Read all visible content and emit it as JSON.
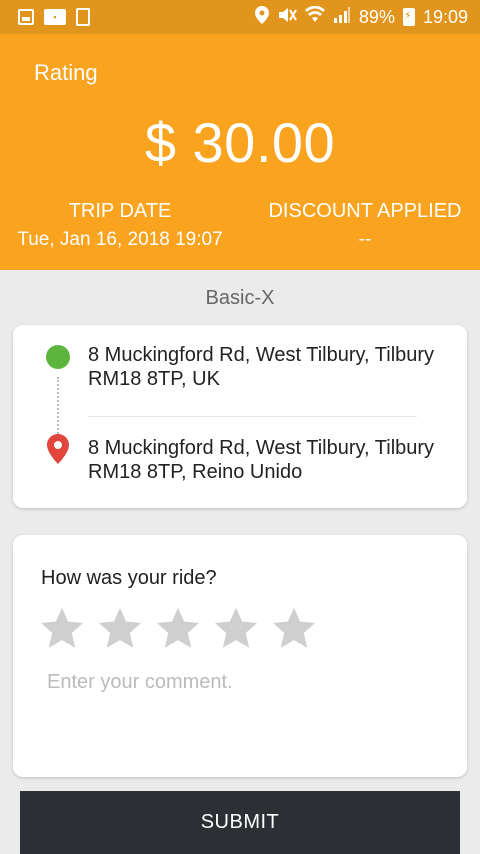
{
  "status_bar": {
    "battery": "89%",
    "time": "19:09",
    "icons": [
      "gallery-icon",
      "app-notification-icon",
      "document-icon",
      "location-icon",
      "mute-icon",
      "wifi-icon",
      "signal-icon",
      "battery-charging-icon"
    ]
  },
  "header": {
    "title": "Rating",
    "amount": "$ 30.00",
    "trip_date_label": "TRIP DATE",
    "trip_date_value": "Tue, Jan 16, 2018 19:07",
    "discount_label": "DISCOUNT APPLIED",
    "discount_value": "--"
  },
  "vehicle_type": "Basic-X",
  "route": {
    "pickup": "8 Muckingford Rd, West Tilbury, Tilbury RM18 8TP, UK",
    "dropoff": "8 Muckingford Rd, West Tilbury, Tilbury RM18 8TP, Reino Unido"
  },
  "rating": {
    "question": "How was your ride?",
    "stars_total": 5,
    "stars_selected": 0,
    "comment_placeholder": "Enter your comment.",
    "comment_value": ""
  },
  "submit_label": "SUBMIT",
  "colors": {
    "header_bg": "#f9a31f",
    "status_bar_bg": "#e2951c",
    "pickup_green": "#5cb63e",
    "dropoff_red": "#e2453b",
    "star_gray": "#cfcfcf",
    "button_dark": "#2c2f33"
  }
}
